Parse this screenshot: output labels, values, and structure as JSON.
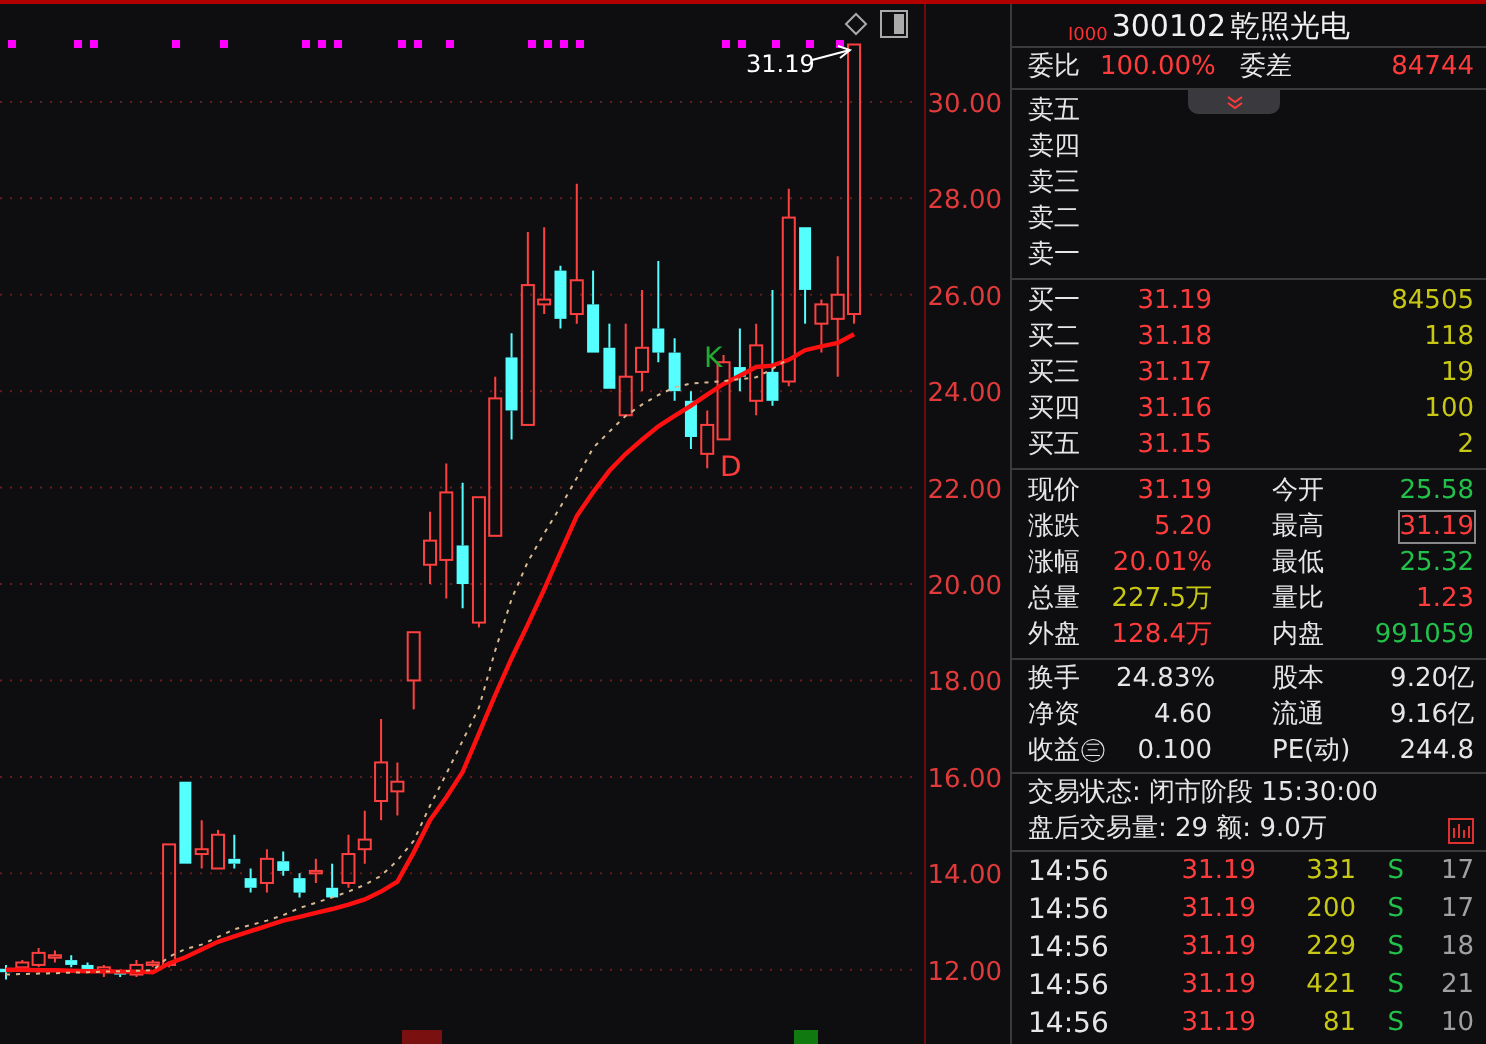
{
  "chart": {
    "chart_data": {
      "type": "candlestick",
      "ylim": [
        10.46,
        32.03
      ],
      "grid": true,
      "ohlc": [
        [
          12.02,
          12.1,
          11.8,
          11.95
        ],
        [
          12.05,
          12.2,
          12.0,
          12.15
        ],
        [
          12.1,
          12.45,
          12.05,
          12.35
        ],
        [
          12.25,
          12.4,
          12.15,
          12.3
        ],
        [
          12.2,
          12.3,
          12.05,
          12.1
        ],
        [
          12.1,
          12.15,
          11.95,
          12.0
        ],
        [
          11.95,
          12.1,
          11.85,
          12.05
        ],
        [
          11.95,
          12.0,
          11.85,
          11.9
        ],
        [
          11.9,
          12.2,
          11.85,
          12.1
        ],
        [
          12.1,
          12.2,
          12.05,
          12.15
        ],
        [
          12.1,
          14.6,
          12.05,
          14.6
        ],
        [
          15.9,
          15.9,
          14.2,
          14.2
        ],
        [
          14.4,
          15.1,
          14.1,
          14.5
        ],
        [
          14.1,
          14.9,
          14.1,
          14.8
        ],
        [
          14.3,
          14.8,
          14.1,
          14.2
        ],
        [
          13.9,
          14.1,
          13.6,
          13.7
        ],
        [
          13.8,
          14.5,
          13.6,
          14.3
        ],
        [
          14.25,
          14.45,
          13.95,
          14.05
        ],
        [
          13.9,
          14.0,
          13.5,
          13.6
        ],
        [
          14.0,
          14.3,
          13.8,
          14.05
        ],
        [
          13.7,
          14.2,
          13.5,
          13.5
        ],
        [
          13.8,
          14.8,
          13.7,
          14.4
        ],
        [
          14.5,
          15.3,
          14.2,
          14.7
        ],
        [
          15.5,
          17.2,
          15.1,
          16.3
        ],
        [
          15.7,
          16.3,
          15.2,
          15.9
        ],
        [
          18.0,
          19.0,
          17.4,
          19.0
        ],
        [
          20.4,
          21.5,
          20.0,
          20.9
        ],
        [
          20.5,
          22.5,
          19.7,
          21.9
        ],
        [
          20.8,
          22.1,
          19.5,
          20.0
        ],
        [
          19.2,
          21.8,
          19.1,
          21.8
        ],
        [
          21.0,
          24.3,
          21.0,
          23.85
        ],
        [
          24.7,
          25.2,
          23.0,
          23.6
        ],
        [
          23.3,
          27.3,
          23.3,
          26.2
        ],
        [
          25.8,
          27.4,
          25.6,
          25.9
        ],
        [
          26.5,
          26.6,
          25.3,
          25.5
        ],
        [
          25.6,
          28.3,
          25.4,
          26.3
        ],
        [
          25.8,
          26.5,
          24.8,
          24.8
        ],
        [
          24.9,
          25.4,
          24.05,
          24.05
        ],
        [
          23.5,
          25.4,
          23.5,
          24.3
        ],
        [
          24.4,
          26.1,
          24.0,
          24.9
        ],
        [
          25.3,
          26.7,
          24.6,
          24.8
        ],
        [
          24.8,
          25.1,
          23.8,
          24.0
        ],
        [
          23.8,
          24.0,
          22.8,
          23.05
        ],
        [
          22.7,
          23.6,
          22.4,
          23.3
        ],
        [
          23.0,
          24.75,
          23.0,
          24.6
        ],
        [
          24.5,
          25.3,
          24.0,
          24.3
        ],
        [
          23.8,
          25.4,
          23.5,
          24.95
        ],
        [
          24.4,
          26.1,
          23.7,
          23.8
        ],
        [
          24.2,
          28.2,
          24.1,
          27.6
        ],
        [
          27.4,
          27.4,
          25.4,
          26.1
        ],
        [
          25.4,
          25.9,
          24.8,
          25.8
        ],
        [
          25.5,
          26.8,
          24.3,
          26.0
        ],
        [
          25.6,
          31.19,
          25.4,
          31.19
        ]
      ],
      "yticks": [
        {
          "value": 30,
          "label": "30.00"
        },
        {
          "value": 28,
          "label": "28.00"
        },
        {
          "value": 26,
          "label": "26.00"
        },
        {
          "value": 24,
          "label": "24.00"
        },
        {
          "value": 22,
          "label": "22.00"
        },
        {
          "value": 20,
          "label": "20.00"
        },
        {
          "value": 18,
          "label": "18.00"
        },
        {
          "value": 16,
          "label": "16.00"
        },
        {
          "value": 14,
          "label": "14.00"
        },
        {
          "value": 12,
          "label": "12.00"
        }
      ],
      "series": [
        {
          "type": "line",
          "color": "#ff1010",
          "line_style": "solid",
          "values": [
            12.0,
            12.0,
            11.99,
            11.99,
            11.98,
            11.97,
            11.97,
            11.96,
            11.96,
            11.95,
            12.13,
            12.26,
            12.42,
            12.58,
            12.69,
            12.8,
            12.91,
            13.02,
            13.1,
            13.18,
            13.26,
            13.35,
            13.46,
            13.62,
            13.83,
            14.43,
            15.1,
            15.58,
            16.1,
            16.9,
            17.7,
            18.46,
            19.16,
            19.89,
            20.65,
            21.41,
            21.9,
            22.35,
            22.7,
            22.99,
            23.27,
            23.49,
            23.7,
            23.93,
            24.15,
            24.32,
            24.5,
            24.53,
            24.65,
            24.85,
            24.93,
            25.0,
            25.18
          ]
        },
        {
          "type": "line",
          "color": "#d8b890",
          "line_style": "dashed",
          "values": [
            11.9,
            11.91,
            11.92,
            11.93,
            11.94,
            11.95,
            11.96,
            11.97,
            11.98,
            11.99,
            12.27,
            12.43,
            12.52,
            12.68,
            12.84,
            12.93,
            13.02,
            13.13,
            13.28,
            13.39,
            13.5,
            13.62,
            13.76,
            13.95,
            14.27,
            14.67,
            15.4,
            16.07,
            16.75,
            17.44,
            18.62,
            19.69,
            20.46,
            21.05,
            21.6,
            22.2,
            22.82,
            23.16,
            23.49,
            23.72,
            23.92,
            24.08,
            24.16,
            24.18,
            24.21,
            24.25,
            24.29,
            24.46,
            24.67,
            null,
            null,
            null,
            null
          ]
        }
      ]
    },
    "last_price_label": "31.19",
    "indicator_labels": [
      {
        "text": "K",
        "color": "#22aa33"
      },
      {
        "text": "D",
        "color": "#ff3b3b"
      }
    ]
  },
  "stock": {
    "market_tag": "I000",
    "code": "300102",
    "name": "乾照光电"
  },
  "order_ratio": [
    {
      "label": "委比",
      "value": "100.00%",
      "color": "#ff3b3b"
    },
    {
      "label": "委差",
      "value": "84744",
      "color": "#ff3b3b"
    }
  ],
  "sell_orders": [
    {
      "label": "卖五"
    },
    {
      "label": "卖四"
    },
    {
      "label": "卖三"
    },
    {
      "label": "卖二"
    },
    {
      "label": "卖一"
    }
  ],
  "buy_orders": [
    {
      "label": "买一",
      "price": "31.19",
      "volume": "84505"
    },
    {
      "label": "买二",
      "price": "31.18",
      "volume": "118"
    },
    {
      "label": "买三",
      "price": "31.17",
      "volume": "19"
    },
    {
      "label": "买四",
      "price": "31.16",
      "volume": "100"
    },
    {
      "label": "买五",
      "price": "31.15",
      "volume": "2"
    }
  ],
  "quote": [
    {
      "label": "现价",
      "value": "31.19",
      "color": "#ff3b3b",
      "highlighted": false
    },
    {
      "label": "今开",
      "value": "25.58",
      "color": "#22c24a",
      "highlighted": false
    },
    {
      "label": "涨跌",
      "value": "5.20",
      "color": "#ff3b3b",
      "highlighted": false
    },
    {
      "label": "最高",
      "value": "31.19",
      "color": "#ff3b3b",
      "highlighted": true
    },
    {
      "label": "涨幅",
      "value": "20.01%",
      "color": "#ff3b3b",
      "highlighted": false
    },
    {
      "label": "最低",
      "value": "25.32",
      "color": "#22c24a",
      "highlighted": false
    },
    {
      "label": "总量",
      "value": "227.5万",
      "color": "#c8c814",
      "highlighted": false
    },
    {
      "label": "量比",
      "value": "1.23",
      "color": "#ff3b3b",
      "highlighted": false
    },
    {
      "label": "外盘",
      "value": "128.4万",
      "color": "#ff3b3b",
      "highlighted": false
    },
    {
      "label": "内盘",
      "value": "991059",
      "color": "#22c24a",
      "highlighted": false
    }
  ],
  "stats": [
    {
      "label": "换手",
      "value": "24.83%"
    },
    {
      "label": "股本",
      "value": "9.20亿"
    },
    {
      "label": "净资",
      "value": "4.60"
    },
    {
      "label": "流通",
      "value": "9.16亿"
    },
    {
      "label": "收益㊂",
      "value": "0.100"
    },
    {
      "label": "PE(动)",
      "value": "244.8"
    }
  ],
  "status": {
    "state_line": "交易状态: 闭市阶段 15:30:00",
    "after_hours_line": "盘后交易量: 29  额: 9.0万"
  },
  "trades": [
    {
      "time": "14:56",
      "price": "31.19",
      "volume": "331",
      "side": "S",
      "count": "17"
    },
    {
      "time": "14:56",
      "price": "31.19",
      "volume": "200",
      "side": "S",
      "count": "17"
    },
    {
      "time": "14:56",
      "price": "31.19",
      "volume": "229",
      "side": "S",
      "count": "18"
    },
    {
      "time": "14:56",
      "price": "31.19",
      "volume": "421",
      "side": "S",
      "count": "21"
    },
    {
      "time": "14:56",
      "price": "31.19",
      "volume": "81",
      "side": "S",
      "count": "10"
    }
  ]
}
